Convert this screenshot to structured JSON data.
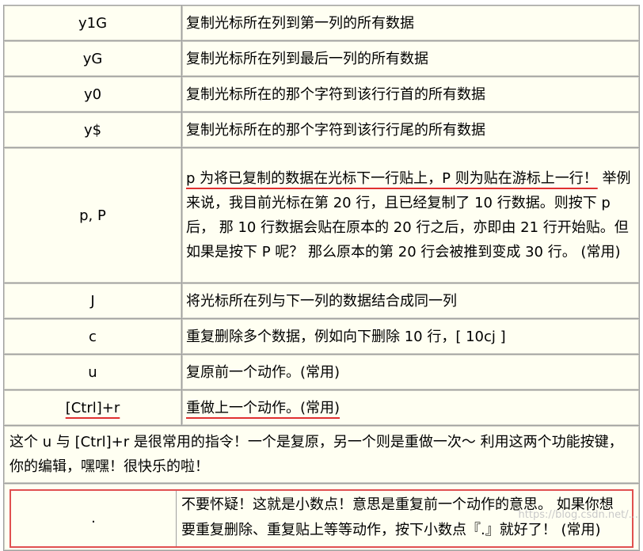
{
  "rows": [
    {
      "key": "y1G",
      "desc": "复制光标所在列到第一列的所有数据"
    },
    {
      "key": "yG",
      "desc": "复制光标所在列到最后一列的所有数据"
    },
    {
      "key": "y0",
      "desc": "复制光标所在的那个字符到该行行首的所有数据"
    },
    {
      "key": "y$",
      "desc": "复制光标所在的那个字符到该行行尾的所有数据"
    }
  ],
  "p_row": {
    "key": "p, P",
    "desc_first": "p 为将已复制的数据在光标下一行贴上，P 则为贴在游标上一行！",
    "desc_rest": " 举例来说，我目前光标在第 20 行，且已经复制了 10 行数据。则按下 p 后， 那 10 行数据会贴在原本的 20 行之后，亦即由 21 行开始贴。但如果是按下 P 呢？ 那么原本的第 20 行会被推到变成 30 行。 (常用)"
  },
  "rows2": [
    {
      "key": "J",
      "desc": "将光标所在列与下一列的数据结合成同一列"
    },
    {
      "key": "c",
      "desc": "重复删除多个数据，例如向下删除 10 行，[ 10cj ]"
    },
    {
      "key": "u",
      "desc": "复原前一个动作。(常用)"
    },
    {
      "key": "[Ctrl]+r",
      "desc": "重做上一个动作。(常用)"
    }
  ],
  "note": "这个 u 与 [Ctrl]+r 是很常用的指令！一个是复原，另一个则是重做一次～ 利用这两个功能按键，你的编辑，嘿嘿！很快乐的啦！",
  "dot_row": {
    "key": ".",
    "desc": "不要怀疑！这就是小数点！意思是重复前一个动作的意思。 如果你想要重复删除、重复贴上等等动作，按下小数点『.』就好了！ (常用)"
  },
  "watermark": "https://blog.csdn.net/..."
}
